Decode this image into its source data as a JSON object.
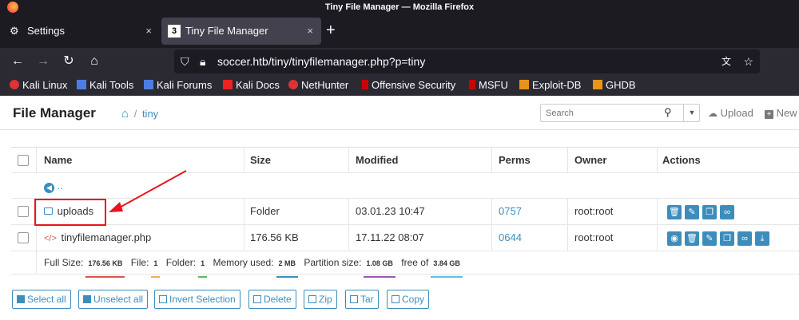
{
  "window": {
    "title": "Tiny File Manager — Mozilla Firefox"
  },
  "tabs": [
    {
      "label": "Settings",
      "close": "×"
    },
    {
      "label": "Tiny File Manager",
      "close": "×"
    }
  ],
  "new_tab": "+",
  "nav": {
    "url": "soccer.htb/tiny/tinyfilemanager.php?p=tiny"
  },
  "bookmarks": [
    "Kali Linux",
    "Kali Tools",
    "Kali Forums",
    "Kali Docs",
    "NetHunter",
    "Offensive Security",
    "MSFU",
    "Exploit-DB",
    "GHDB"
  ],
  "fm": {
    "brand": "File Manager",
    "crumb": "tiny",
    "search_placeholder": "Search",
    "upload": "Upload",
    "new": "New"
  },
  "table": {
    "headers": {
      "name": "Name",
      "size": "Size",
      "modified": "Modified",
      "perms": "Perms",
      "owner": "Owner",
      "actions": "Actions"
    },
    "parent": "..",
    "rows": [
      {
        "name": "uploads",
        "size": "Folder",
        "modified": "03.01.23 10:47",
        "perms": "0757",
        "owner": "root:root"
      },
      {
        "name": "tinyfilemanager.php",
        "size": "176.56 KB",
        "modified": "17.11.22 08:07",
        "perms": "0644",
        "owner": "root:root"
      }
    ],
    "footer": {
      "full_size_label": "Full Size:",
      "full_size": "176.56 KB",
      "file_label": "File:",
      "file": "1",
      "folder_label": "Folder:",
      "folder": "1",
      "memory_label": "Memory used:",
      "memory": "2 MB",
      "partition_label": "Partition size:",
      "partition": "1.08 GB",
      "free_label": "free of",
      "free": "3.84 GB"
    }
  },
  "buttons": [
    "Select all",
    "Unselect all",
    "Invert Selection",
    "Delete",
    "Zip",
    "Tar",
    "Copy"
  ],
  "colors": {
    "accent": "#3c8dbc",
    "annotation": "#e8141b"
  }
}
